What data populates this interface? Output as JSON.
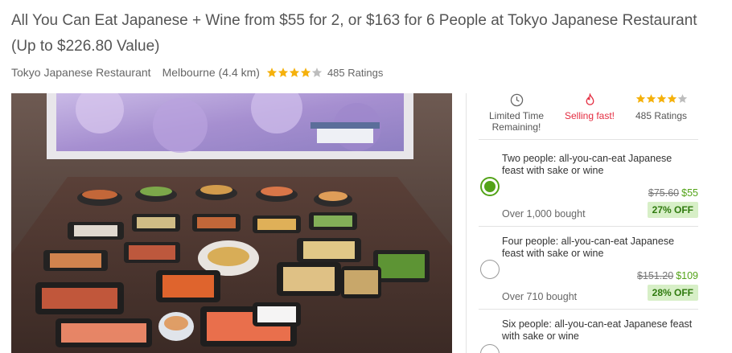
{
  "deal": {
    "title": "All You Can Eat Japanese + Wine from $55 for 2, or $163 for 6 People at Tokyo Japanese Restaurant (Up to $226.80 Value)",
    "merchant": "Tokyo Japanese Restaurant",
    "location": "Melbourne (4.4 km)",
    "rating_stars": 4,
    "ratings_text": "485 Ratings"
  },
  "badges": {
    "time": "Limited Time Remaining!",
    "selling": "Selling fast!",
    "ratings": "485 Ratings"
  },
  "options": [
    {
      "title": "Two people: all-you-can-eat Japanese feast with sake or wine",
      "was": "$75.60",
      "now": "$55",
      "bought": "Over 1,000 bought",
      "discount": "27% OFF",
      "selected": true
    },
    {
      "title": "Four people: all-you-can-eat Japanese feast with sake or wine",
      "was": "$151.20",
      "now": "$109",
      "bought": "Over 710 bought",
      "discount": "28% OFF",
      "selected": false
    },
    {
      "title": "Six people: all-you-can-eat Japanese feast with sake or wine",
      "selected": false
    }
  ],
  "colors": {
    "accent": "#53a318",
    "star": "#f5b10c",
    "selling": "#e42c40",
    "discount_bg": "#d7efc7"
  }
}
